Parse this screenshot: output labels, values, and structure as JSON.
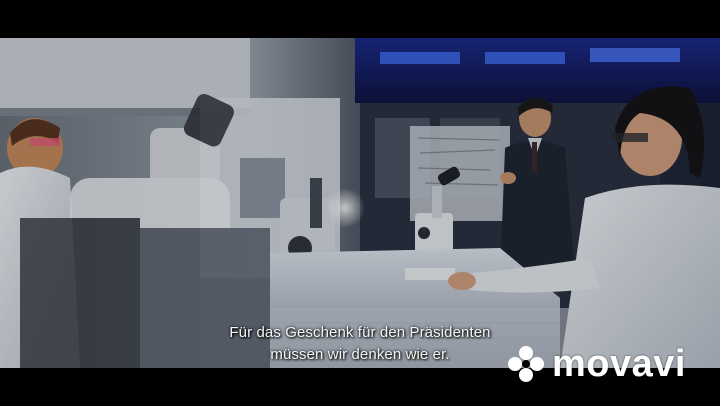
{
  "video": {
    "scene": "laboratory",
    "letterbox_color": "#000000"
  },
  "subtitles": {
    "line1": "Für das Geschenk für den Präsidenten",
    "line2": "müssen wir denken wie er."
  },
  "watermark": {
    "text": "movavi",
    "icon": "movavi-flower-icon",
    "color": "#ffffff"
  }
}
